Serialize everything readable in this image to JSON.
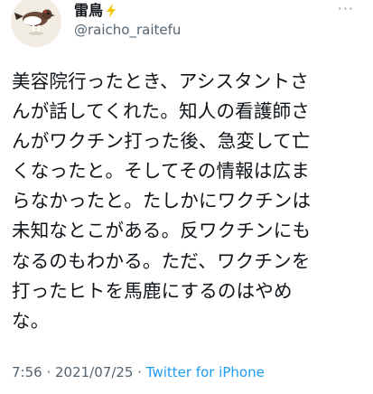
{
  "author": {
    "display_name": "雷鳥",
    "handle": "@raicho_raitefu",
    "avatar_icon": "ptarmigan-bird-avatar",
    "badge_icon": "lightning-bolt-icon",
    "badge_color": "#f5c400"
  },
  "more_icon": "more-options-icon",
  "tweet_lines": [
    "美容院行ったとき、アシスタントさ",
    "んが話してくれた。知人の看護師さ",
    "んがワクチン打った後、急変して亡",
    "くなったと。そしてその情報は広ま",
    "らなかったと。たしかにワクチンは",
    "未知なとこがある。反ワクチンにも",
    "なるのもわかる。ただ、ワクチンを",
    "打ったヒトを馬鹿にするのはやめ",
    "な。"
  ],
  "meta": {
    "time": "7:56",
    "separator": " · ",
    "date": "2021/07/25",
    "source": "Twitter for iPhone"
  },
  "colors": {
    "text": "#0f1419",
    "secondary": "#536471",
    "link": "#1d9bf0"
  }
}
